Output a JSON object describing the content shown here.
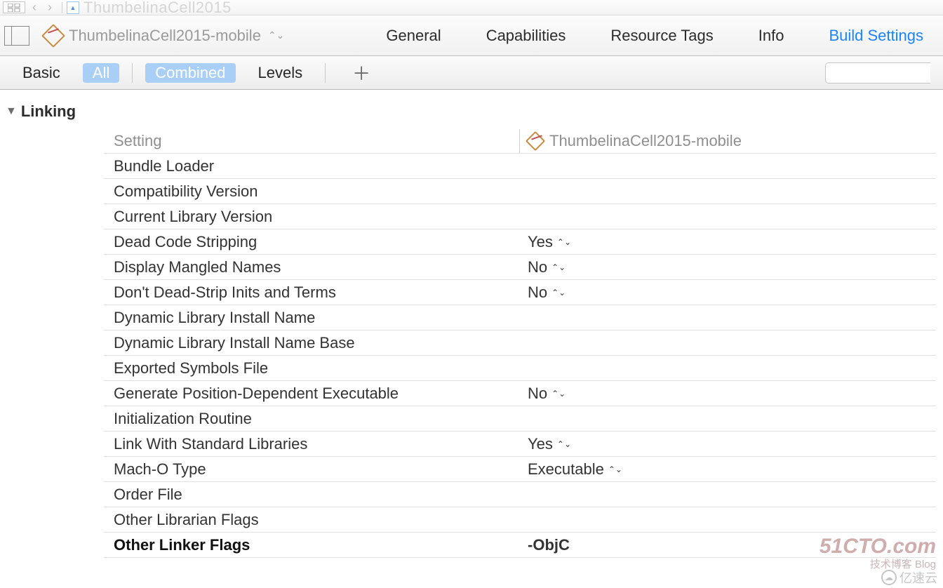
{
  "breadcrumb": {
    "title": "ThumbelinaCell2015"
  },
  "target": {
    "name": "ThumbelinaCell2015-mobile"
  },
  "tabs": {
    "general": "General",
    "capabilities": "Capabilities",
    "resource_tags": "Resource Tags",
    "info": "Info",
    "build_settings": "Build Settings"
  },
  "filter": {
    "basic": "Basic",
    "all": "All",
    "combined": "Combined",
    "levels": "Levels",
    "search_placeholder": ""
  },
  "section": {
    "title": "Linking"
  },
  "columns": {
    "setting": "Setting",
    "target": "ThumbelinaCell2015-mobile"
  },
  "settings": [
    {
      "name": "Bundle Loader",
      "value": "",
      "dropdown": false,
      "bold": false
    },
    {
      "name": "Compatibility Version",
      "value": "",
      "dropdown": false,
      "bold": false
    },
    {
      "name": "Current Library Version",
      "value": "",
      "dropdown": false,
      "bold": false
    },
    {
      "name": "Dead Code Stripping",
      "value": "Yes",
      "dropdown": true,
      "bold": false
    },
    {
      "name": "Display Mangled Names",
      "value": "No",
      "dropdown": true,
      "bold": false
    },
    {
      "name": "Don't Dead-Strip Inits and Terms",
      "value": "No",
      "dropdown": true,
      "bold": false
    },
    {
      "name": "Dynamic Library Install Name",
      "value": "",
      "dropdown": false,
      "bold": false
    },
    {
      "name": "Dynamic Library Install Name Base",
      "value": "",
      "dropdown": false,
      "bold": false
    },
    {
      "name": "Exported Symbols File",
      "value": "",
      "dropdown": false,
      "bold": false
    },
    {
      "name": "Generate Position-Dependent Executable",
      "value": "No",
      "dropdown": true,
      "bold": false
    },
    {
      "name": "Initialization Routine",
      "value": "",
      "dropdown": false,
      "bold": false
    },
    {
      "name": "Link With Standard Libraries",
      "value": "Yes",
      "dropdown": true,
      "bold": false
    },
    {
      "name": "Mach-O Type",
      "value": "Executable",
      "dropdown": true,
      "bold": false
    },
    {
      "name": "Order File",
      "value": "",
      "dropdown": false,
      "bold": false
    },
    {
      "name": "Other Librarian Flags",
      "value": "",
      "dropdown": false,
      "bold": false
    },
    {
      "name": "Other Linker Flags",
      "value": "-ObjC",
      "dropdown": false,
      "bold": true
    }
  ],
  "watermarks": {
    "a": "51CTO.com",
    "b": "技术博客  Blog",
    "c": "亿速云"
  }
}
